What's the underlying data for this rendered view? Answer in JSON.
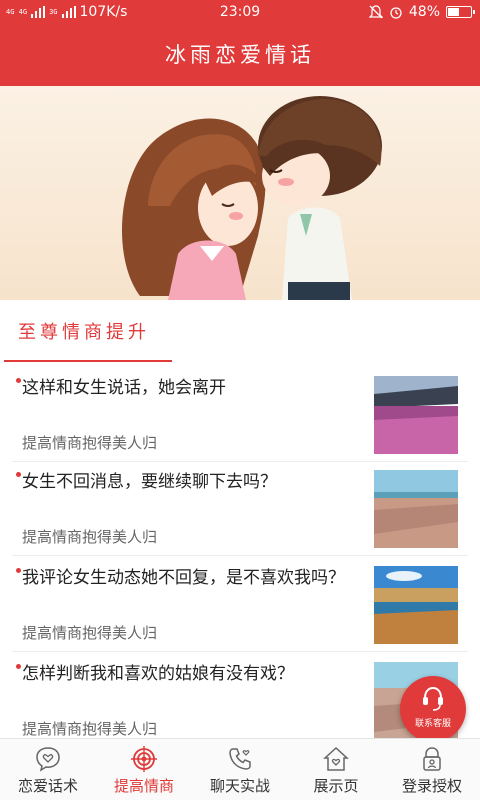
{
  "status_bar": {
    "signal_1": "4G 4G",
    "signal_2": "3G",
    "speed": "107K/s",
    "time": "23:09",
    "battery": "48%",
    "battery_level": 0.48
  },
  "header": {
    "title": "冰雨恋爱情话"
  },
  "banner": {
    "slide_count": 5,
    "active_slide": 0
  },
  "section": {
    "title": "至尊情商提升"
  },
  "articles": [
    {
      "title": "这样和女生说话，她会离开",
      "subtitle": "提高情商抱得美人归",
      "thumb": "lavender-field"
    },
    {
      "title": "女生不回消息，要继续聊下去吗？",
      "subtitle": "提高情商抱得美人归",
      "thumb": "beach-road"
    },
    {
      "title": "我评论女生动态她不回复，是不喜欢我吗？",
      "subtitle": "提高情商抱得美人归",
      "thumb": "desert-lake"
    },
    {
      "title": "怎样判断我和喜欢的姑娘有没有戏？",
      "subtitle": "提高情商抱得美人归",
      "thumb": "road-sky"
    }
  ],
  "float_button": {
    "label": "联系客服"
  },
  "tabs": [
    {
      "label": "恋爱话术",
      "icon": "heart-chat-icon",
      "active": false
    },
    {
      "label": "提高情商",
      "icon": "target-icon",
      "active": true
    },
    {
      "label": "聊天实战",
      "icon": "phone-heart-icon",
      "active": false
    },
    {
      "label": "展示页",
      "icon": "house-heart-icon",
      "active": false
    },
    {
      "label": "登录授权",
      "icon": "lock-user-icon",
      "active": false
    }
  ],
  "colors": {
    "accent": "#e03a3a",
    "text": "#222222",
    "subtext": "#666666"
  }
}
